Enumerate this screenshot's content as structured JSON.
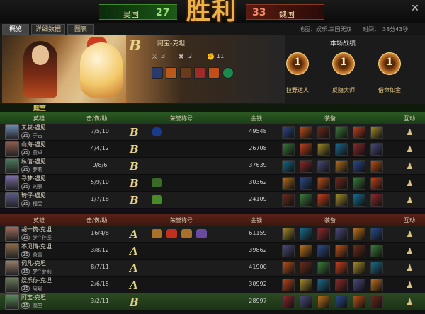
{
  "header": {
    "left_team": "吴国",
    "left_score": "27",
    "right_team": "魏国",
    "right_score": "33",
    "result": "胜利",
    "close_icon": "close-icon"
  },
  "tabs": [
    "概览",
    "详细数据",
    "图表"
  ],
  "map_info": "地图：娱乐.三国无双",
  "time_info": "时间：　38分43秒",
  "banner": {
    "grade": "B",
    "hero_title": "阿宝-克坦",
    "kills": "3",
    "deaths": "2",
    "assists": "11",
    "record_title": "本场战绩",
    "medals": [
      {
        "num": "1",
        "label": "拉野达人"
      },
      {
        "num": "1",
        "label": "反隐大师"
      },
      {
        "num": "1",
        "label": "借命如金"
      }
    ]
  },
  "team1": {
    "name": "糜竺",
    "headers": {
      "hero": "英雄",
      "kda": "击/伤/助",
      "honor": "荣誉称号",
      "gold": "金钱",
      "equip": "装备",
      "interact": "互动"
    },
    "rows": [
      {
        "name": "天叔-遇见",
        "level": "25",
        "user": "于吉",
        "kda": "7/5/10",
        "grade": "B",
        "gold": "49548"
      },
      {
        "name": "山海-遇见",
        "level": "25",
        "user": "董卓",
        "kda": "4/4/12",
        "grade": "B",
        "gold": "26708"
      },
      {
        "name": "私信-遇见",
        "level": "25",
        "user": "萝莉",
        "kda": "9/8/6",
        "grade": "B",
        "gold": "37639"
      },
      {
        "name": "寻梦-遇见",
        "level": "25",
        "user": "刘表",
        "kda": "5/9/10",
        "grade": "B",
        "gold": "30362"
      },
      {
        "name": "琦仔-遇见",
        "level": "25",
        "user": "程昱",
        "kda": "1/7/18",
        "grade": "B",
        "gold": "24109"
      }
    ]
  },
  "team2": {
    "headers": {
      "hero": "英雄",
      "kda": "击/伤/助",
      "honor": "荣誉称号",
      "gold": "金钱",
      "equip": "装备",
      "interact": "互动"
    },
    "rows": [
      {
        "name": "胡一筒-克坦",
        "level": "25",
        "user": "梦^孙坚",
        "kda": "16/4/8",
        "grade": "A",
        "gold": "61159"
      },
      {
        "name": "不见情-克坦",
        "level": "25",
        "user": "黄盖",
        "kda": "3/8/12",
        "grade": "A",
        "gold": "39862"
      },
      {
        "name": "词凡-克坦",
        "level": "25",
        "user": "梦^萝莉",
        "kda": "8/7/11",
        "grade": "A",
        "gold": "41900"
      },
      {
        "name": "娱乐你-克坦",
        "level": "25",
        "user": "周瑜",
        "kda": "2/6/15",
        "grade": "A",
        "gold": "30992"
      },
      {
        "name": "阿宝-克坦",
        "level": "25",
        "user": "糜竺",
        "kda": "3/2/11",
        "grade": "B",
        "gold": "28997"
      }
    ]
  }
}
